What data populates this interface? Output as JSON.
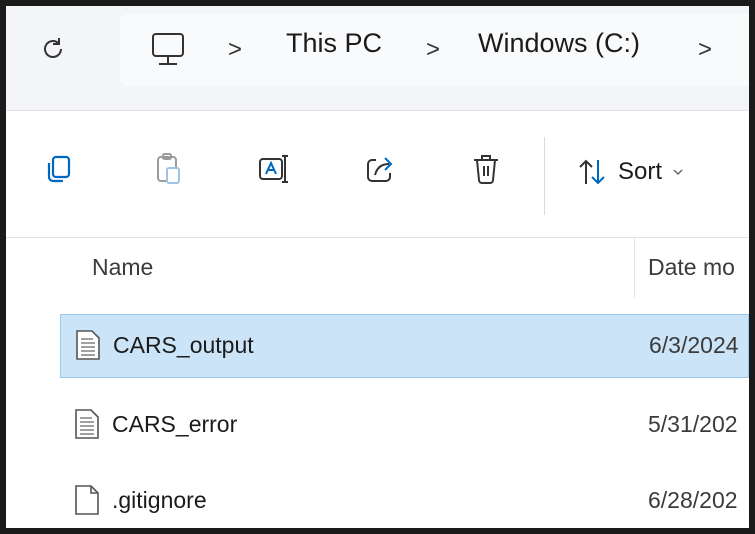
{
  "addressbar": {
    "refresh_icon": "refresh-icon",
    "pc_icon": "monitor-icon",
    "separator": ">",
    "crumbs": [
      "This PC",
      "Windows (C:)"
    ]
  },
  "toolbar": {
    "buttons": [
      "copy-icon",
      "paste-icon",
      "rename-icon",
      "share-icon",
      "delete-icon"
    ],
    "sort_label": "Sort",
    "sort_icon": "sort-arrows-icon"
  },
  "columns": {
    "name": "Name",
    "date": "Date mo"
  },
  "files": [
    {
      "name": "CARS_output",
      "date": "6/3/2024",
      "icon": "text-file-icon",
      "selected": true
    },
    {
      "name": "CARS_error",
      "date": "5/31/202",
      "icon": "text-file-icon",
      "selected": false
    },
    {
      "name": ".gitignore",
      "date": "6/28/202",
      "icon": "blank-file-icon",
      "selected": false
    }
  ],
  "colors": {
    "selection": "#cce4f7",
    "selection_border": "#99c9ef",
    "addressbar_bg": "#f3f5f9"
  }
}
